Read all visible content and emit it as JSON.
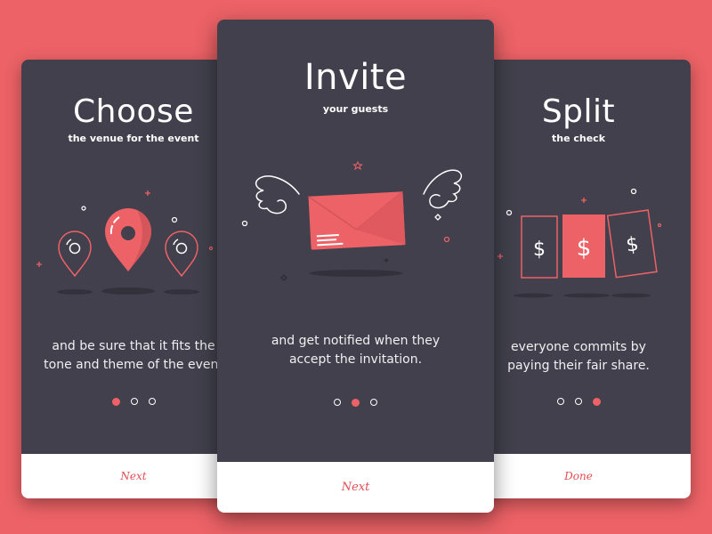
{
  "colors": {
    "background": "#ec6266",
    "card": "#41404c",
    "accent": "#ec6266",
    "footer": "#ffffff"
  },
  "cards": [
    {
      "title": "Choose",
      "subtitle": "the venue for the event",
      "body": "and be sure that it fits the\ntone and theme of the event",
      "illustration": "map-pins",
      "pagination": {
        "total": 3,
        "active": 1
      },
      "action_label": "Next"
    },
    {
      "title": "Invite",
      "subtitle": "your guests",
      "body": "and get notified when they\naccept the invitation.",
      "illustration": "winged-envelope",
      "pagination": {
        "total": 3,
        "active": 2
      },
      "action_label": "Next"
    },
    {
      "title": "Split",
      "subtitle": "the check",
      "body": "everyone commits by\npaying their fair share.",
      "illustration": "dollar-tickets",
      "pagination": {
        "total": 3,
        "active": 3
      },
      "action_label": "Done"
    }
  ]
}
